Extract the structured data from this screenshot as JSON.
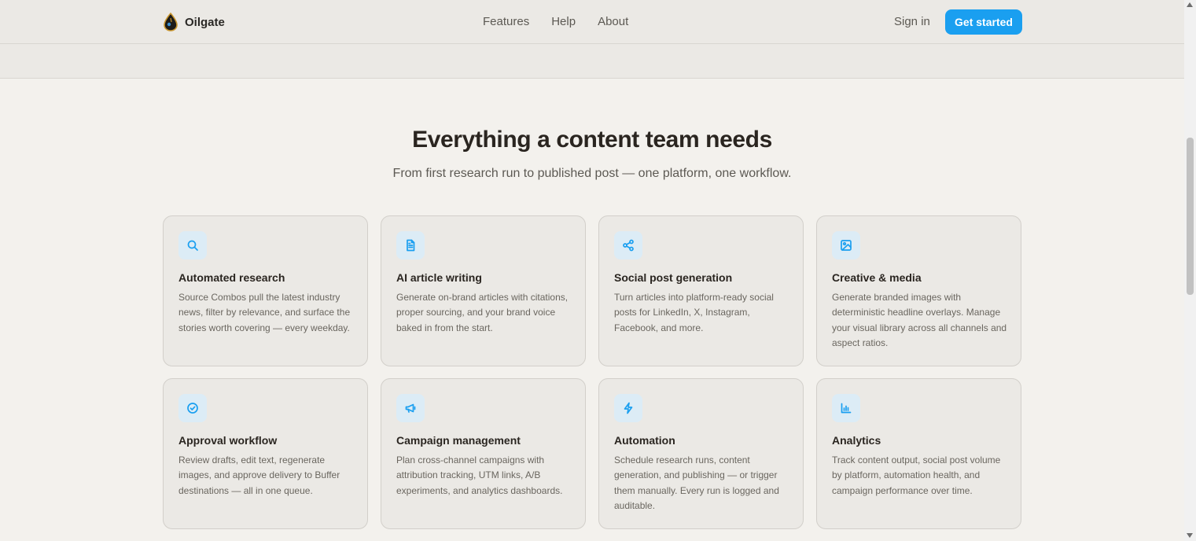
{
  "header": {
    "brand": "Oilgate",
    "nav": [
      {
        "label": "Features"
      },
      {
        "label": "Help"
      },
      {
        "label": "About"
      }
    ],
    "signin_label": "Sign in",
    "cta_label": "Get started"
  },
  "hero": {
    "title": "Everything a content team needs",
    "subtitle": "From first research run to published post — one platform, one workflow."
  },
  "features": [
    {
      "icon": "search-icon",
      "title": "Automated research",
      "desc": "Source Combos pull the latest industry news, filter by relevance, and surface the stories worth covering — every weekday."
    },
    {
      "icon": "document-icon",
      "title": "AI article writing",
      "desc": "Generate on-brand articles with citations, proper sourcing, and your brand voice baked in from the start."
    },
    {
      "icon": "share-icon",
      "title": "Social post generation",
      "desc": "Turn articles into platform-ready social posts for LinkedIn, X, Instagram, Facebook, and more."
    },
    {
      "icon": "image-icon",
      "title": "Creative & media",
      "desc": "Generate branded images with deterministic headline overlays. Manage your visual library across all channels and aspect ratios."
    },
    {
      "icon": "check-circle-icon",
      "title": "Approval workflow",
      "desc": "Review drafts, edit text, regenerate images, and approve delivery to Buffer destinations — all in one queue."
    },
    {
      "icon": "megaphone-icon",
      "title": "Campaign management",
      "desc": "Plan cross-channel campaigns with attribution tracking, UTM links, A/B experiments, and analytics dashboards."
    },
    {
      "icon": "lightning-icon",
      "title": "Automation",
      "desc": "Schedule research runs, content generation, and publishing — or trigger them manually. Every run is logged and auditable."
    },
    {
      "icon": "bar-chart-icon",
      "title": "Analytics",
      "desc": "Track content output, social post volume by platform, automation health, and campaign performance over time."
    }
  ],
  "colors": {
    "accent": "#1a9ff0",
    "background": "#f3f1ed",
    "card": "#ebe9e5"
  }
}
